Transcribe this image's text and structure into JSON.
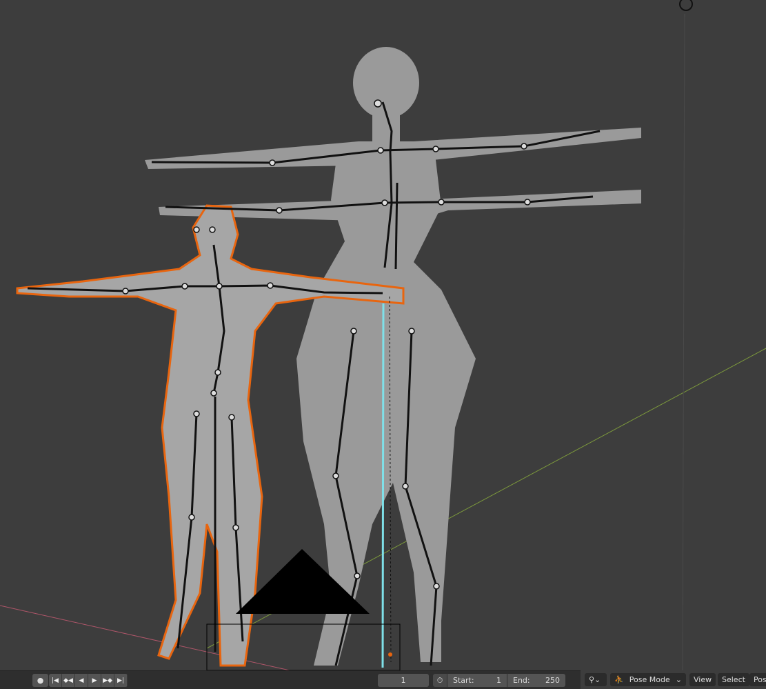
{
  "timeline": {
    "record_icon": "record-icon",
    "playback": [
      "jump-start-icon",
      "prev-keyframe-icon",
      "play-reverse-icon",
      "play-icon",
      "next-keyframe-icon",
      "jump-end-icon"
    ],
    "current_frame": "1",
    "start_label": "Start:",
    "start_value": "1",
    "end_label": "End:",
    "end_value": "250"
  },
  "header": {
    "mode": "Pose Mode",
    "menu": [
      "View",
      "Select",
      "Pose"
    ]
  },
  "colors": {
    "background": "#3d3d3d",
    "selection": "#e8650f",
    "active_bone": "#7fe0e8",
    "x_axis": "#b0566a",
    "y_axis": "#7d9a3c"
  }
}
